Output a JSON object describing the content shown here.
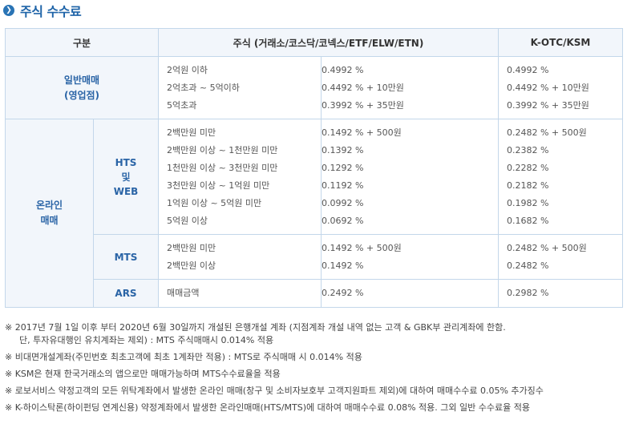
{
  "title": "주식 수수료",
  "title_icon": "chevron-right-icon",
  "header": {
    "category": "구분",
    "stock": "주식 (거래소/코스닥/코넥스/ETF/ELW/ETN)",
    "kotc": "K-OTC/KSM"
  },
  "general": {
    "label_line1": "일반매매",
    "label_line2": "(영업점)",
    "rows": [
      {
        "desc": "2억원 이하",
        "rate": "0.4992 %",
        "kotc": "0.4992 %"
      },
      {
        "desc": "2억초과 ~ 5억이하",
        "rate": "0.4492 % + 10만원",
        "kotc": "0.4492 % + 10만원"
      },
      {
        "desc": "5억초과",
        "rate": "0.3992 % + 35만원",
        "kotc": "0.3992 % + 35만원"
      }
    ]
  },
  "online": {
    "label_line1": "온라인",
    "label_line2": "매매",
    "hts": {
      "label_line1": "HTS",
      "label_line2": "및",
      "label_line3": "WEB",
      "rows": [
        {
          "desc": "2백만원 미만",
          "rate": "0.1492 % + 500원",
          "kotc": "0.2482 % + 500원"
        },
        {
          "desc": "2백만원 이상 ~ 1천만원 미만",
          "rate": "0.1392 %",
          "kotc": "0.2382 %"
        },
        {
          "desc": "1천만원 이상 ~ 3천만원 미만",
          "rate": "0.1292 %",
          "kotc": "0.2282 %"
        },
        {
          "desc": "3천만원 이상 ~ 1억원 미만",
          "rate": "0.1192 %",
          "kotc": "0.2182 %"
        },
        {
          "desc": "1억원 이상 ~ 5억원 미만",
          "rate": "0.0992 %",
          "kotc": "0.1982 %"
        },
        {
          "desc": "5억원 이상",
          "rate": "0.0692 %",
          "kotc": "0.1682 %"
        }
      ]
    },
    "mts": {
      "label": "MTS",
      "rows": [
        {
          "desc": "2백만원 미만",
          "rate": "0.1492 % + 500원",
          "kotc": "0.2482 % + 500원"
        },
        {
          "desc": "2백만원 이상",
          "rate": "0.1492 %",
          "kotc": "0.2482 %"
        }
      ]
    },
    "ars": {
      "label": "ARS",
      "rows": [
        {
          "desc": "매매금액",
          "rate": "0.2492 %",
          "kotc": "0.2982 %"
        }
      ]
    }
  },
  "notes": [
    {
      "text": "※ 2017년 7월 1일 이후 부터 2020년 6월 30일까지 개설된 은행개설 계좌 (지점계좌 개설 내역 없는 고객 & GBK부 관리계좌에 한함.",
      "cont": "단, 투자유대행인 유치계좌는 제외) : MTS 주식매매시 0.014% 적용"
    },
    {
      "text": "※ 비대면개설계좌(주민번호 최초고객에 최초 1계좌만 적용) : MTS로 주식매매 시 0.014% 적용"
    },
    {
      "text": "※ KSM은 현재 한국거래소의 앱으로만 매매가능하며 MTS수수료율을 적용"
    },
    {
      "text": "※ 로보서비스 약정고객의 모든 위탁계좌에서 발생한 온라인 매매(창구 및 소비자보호부 고객지원파트 제외)에 대하여 매매수수료 0.05% 추가징수"
    },
    {
      "text": "※ K-하이스탁론(하이펀딩 연계신용) 약정계좌에서 발생한 온라인매매(HTS/MTS)에 대하여 매매수수료 0.08% 적용. 그외 일반 수수료율 적용"
    }
  ]
}
